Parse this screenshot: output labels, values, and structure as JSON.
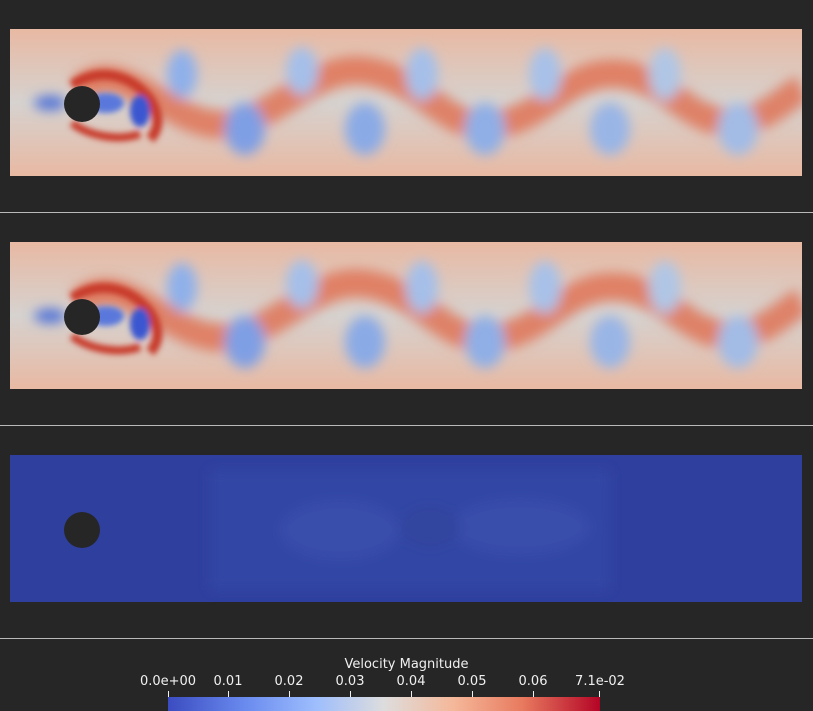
{
  "colorbar": {
    "title": "Velocity Magnitude",
    "labels": [
      "0.0e+00",
      "0.01",
      "0.02",
      "0.03",
      "0.04",
      "0.05",
      "0.06",
      "7.1e-02"
    ],
    "colors": [
      "#3b4cc0",
      "#dddddd",
      "#b40426"
    ]
  },
  "viewports": [
    {
      "name": "flow-field-top",
      "state": "vortex-street"
    },
    {
      "name": "flow-field-middle",
      "state": "vortex-street"
    },
    {
      "name": "flow-field-bottom",
      "state": "near-zero-field"
    }
  ],
  "theme": {
    "background": "#262626",
    "separator": "#b9b9b9",
    "cylinder": "#262626",
    "low_field": "#2f3f9e"
  }
}
